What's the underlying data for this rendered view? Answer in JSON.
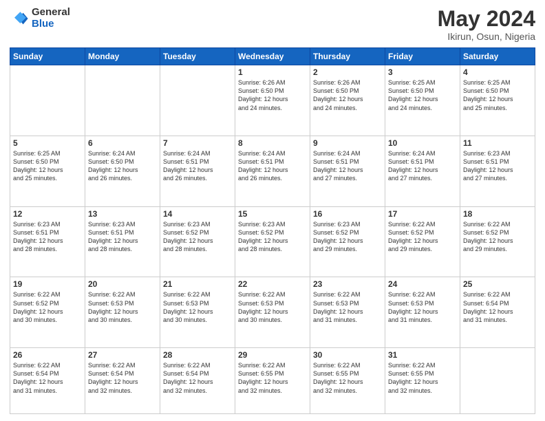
{
  "header": {
    "logo_general": "General",
    "logo_blue": "Blue",
    "title": "May 2024",
    "subtitle": "Ikirun, Osun, Nigeria"
  },
  "columns": [
    "Sunday",
    "Monday",
    "Tuesday",
    "Wednesday",
    "Thursday",
    "Friday",
    "Saturday"
  ],
  "weeks": [
    [
      {
        "day": "",
        "info": ""
      },
      {
        "day": "",
        "info": ""
      },
      {
        "day": "",
        "info": ""
      },
      {
        "day": "1",
        "info": "Sunrise: 6:26 AM\nSunset: 6:50 PM\nDaylight: 12 hours\nand 24 minutes."
      },
      {
        "day": "2",
        "info": "Sunrise: 6:26 AM\nSunset: 6:50 PM\nDaylight: 12 hours\nand 24 minutes."
      },
      {
        "day": "3",
        "info": "Sunrise: 6:25 AM\nSunset: 6:50 PM\nDaylight: 12 hours\nand 24 minutes."
      },
      {
        "day": "4",
        "info": "Sunrise: 6:25 AM\nSunset: 6:50 PM\nDaylight: 12 hours\nand 25 minutes."
      }
    ],
    [
      {
        "day": "5",
        "info": "Sunrise: 6:25 AM\nSunset: 6:50 PM\nDaylight: 12 hours\nand 25 minutes."
      },
      {
        "day": "6",
        "info": "Sunrise: 6:24 AM\nSunset: 6:50 PM\nDaylight: 12 hours\nand 26 minutes."
      },
      {
        "day": "7",
        "info": "Sunrise: 6:24 AM\nSunset: 6:51 PM\nDaylight: 12 hours\nand 26 minutes."
      },
      {
        "day": "8",
        "info": "Sunrise: 6:24 AM\nSunset: 6:51 PM\nDaylight: 12 hours\nand 26 minutes."
      },
      {
        "day": "9",
        "info": "Sunrise: 6:24 AM\nSunset: 6:51 PM\nDaylight: 12 hours\nand 27 minutes."
      },
      {
        "day": "10",
        "info": "Sunrise: 6:24 AM\nSunset: 6:51 PM\nDaylight: 12 hours\nand 27 minutes."
      },
      {
        "day": "11",
        "info": "Sunrise: 6:23 AM\nSunset: 6:51 PM\nDaylight: 12 hours\nand 27 minutes."
      }
    ],
    [
      {
        "day": "12",
        "info": "Sunrise: 6:23 AM\nSunset: 6:51 PM\nDaylight: 12 hours\nand 28 minutes."
      },
      {
        "day": "13",
        "info": "Sunrise: 6:23 AM\nSunset: 6:51 PM\nDaylight: 12 hours\nand 28 minutes."
      },
      {
        "day": "14",
        "info": "Sunrise: 6:23 AM\nSunset: 6:52 PM\nDaylight: 12 hours\nand 28 minutes."
      },
      {
        "day": "15",
        "info": "Sunrise: 6:23 AM\nSunset: 6:52 PM\nDaylight: 12 hours\nand 28 minutes."
      },
      {
        "day": "16",
        "info": "Sunrise: 6:23 AM\nSunset: 6:52 PM\nDaylight: 12 hours\nand 29 minutes."
      },
      {
        "day": "17",
        "info": "Sunrise: 6:22 AM\nSunset: 6:52 PM\nDaylight: 12 hours\nand 29 minutes."
      },
      {
        "day": "18",
        "info": "Sunrise: 6:22 AM\nSunset: 6:52 PM\nDaylight: 12 hours\nand 29 minutes."
      }
    ],
    [
      {
        "day": "19",
        "info": "Sunrise: 6:22 AM\nSunset: 6:52 PM\nDaylight: 12 hours\nand 30 minutes."
      },
      {
        "day": "20",
        "info": "Sunrise: 6:22 AM\nSunset: 6:53 PM\nDaylight: 12 hours\nand 30 minutes."
      },
      {
        "day": "21",
        "info": "Sunrise: 6:22 AM\nSunset: 6:53 PM\nDaylight: 12 hours\nand 30 minutes."
      },
      {
        "day": "22",
        "info": "Sunrise: 6:22 AM\nSunset: 6:53 PM\nDaylight: 12 hours\nand 30 minutes."
      },
      {
        "day": "23",
        "info": "Sunrise: 6:22 AM\nSunset: 6:53 PM\nDaylight: 12 hours\nand 31 minutes."
      },
      {
        "day": "24",
        "info": "Sunrise: 6:22 AM\nSunset: 6:53 PM\nDaylight: 12 hours\nand 31 minutes."
      },
      {
        "day": "25",
        "info": "Sunrise: 6:22 AM\nSunset: 6:54 PM\nDaylight: 12 hours\nand 31 minutes."
      }
    ],
    [
      {
        "day": "26",
        "info": "Sunrise: 6:22 AM\nSunset: 6:54 PM\nDaylight: 12 hours\nand 31 minutes."
      },
      {
        "day": "27",
        "info": "Sunrise: 6:22 AM\nSunset: 6:54 PM\nDaylight: 12 hours\nand 32 minutes."
      },
      {
        "day": "28",
        "info": "Sunrise: 6:22 AM\nSunset: 6:54 PM\nDaylight: 12 hours\nand 32 minutes."
      },
      {
        "day": "29",
        "info": "Sunrise: 6:22 AM\nSunset: 6:55 PM\nDaylight: 12 hours\nand 32 minutes."
      },
      {
        "day": "30",
        "info": "Sunrise: 6:22 AM\nSunset: 6:55 PM\nDaylight: 12 hours\nand 32 minutes."
      },
      {
        "day": "31",
        "info": "Sunrise: 6:22 AM\nSunset: 6:55 PM\nDaylight: 12 hours\nand 32 minutes."
      },
      {
        "day": "",
        "info": ""
      }
    ]
  ]
}
